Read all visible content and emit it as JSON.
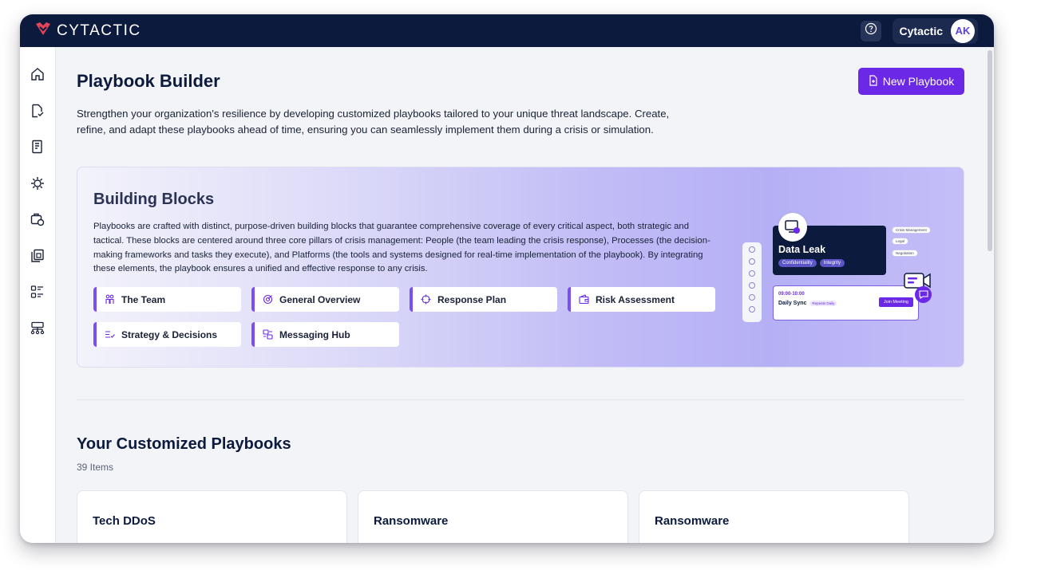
{
  "brand": {
    "name": "CYTACTIC",
    "color": "#e0455a"
  },
  "topbar": {
    "help_icon": "help-circle-icon",
    "user_name": "Cytactic",
    "avatar_initials": "AK"
  },
  "sidebar": {
    "items": [
      {
        "icon": "home-icon"
      },
      {
        "icon": "document-check-icon"
      },
      {
        "icon": "checklist-icon"
      },
      {
        "icon": "virus-icon"
      },
      {
        "icon": "briefcase-settings-icon"
      },
      {
        "icon": "copy-document-icon"
      },
      {
        "icon": "workflow-icon"
      },
      {
        "icon": "org-chart-icon"
      }
    ]
  },
  "header": {
    "title": "Playbook Builder",
    "new_button_label": "New Playbook",
    "intro": "Strengthen your organization's resilience by developing customized playbooks tailored to your unique threat landscape. Create, refine, and adapt these playbooks ahead of time, ensuring you can seamlessly implement them during a crisis or simulation."
  },
  "building_blocks": {
    "title": "Building Blocks",
    "description": "Playbooks are crafted with distinct, purpose-driven building blocks that guarantee comprehensive coverage of every critical aspect, both strategic and tactical. These blocks are centered around three core pillars of crisis management: People (the team leading the crisis response), Processes (the decision-making frameworks and tasks they execute), and Platforms (the tools and systems designed for real-time implementation of the playbook). By integrating these elements, the playbook ensures a unified and effective response to any crisis.",
    "chips": [
      {
        "label": "The Team",
        "icon": "team-icon"
      },
      {
        "label": "General Overview",
        "icon": "target-icon"
      },
      {
        "label": "Response Plan",
        "icon": "crosshair-icon"
      },
      {
        "label": "Risk Assessment",
        "icon": "wallet-icon"
      },
      {
        "label": "Strategy & Decisions",
        "icon": "list-check-icon"
      },
      {
        "label": "Messaging Hub",
        "icon": "messages-icon"
      }
    ],
    "illustration": {
      "leak_title": "Data Leak",
      "tags": [
        "Confidentiality",
        "Integrity"
      ],
      "side_tags": [
        "Crisis Management",
        "Legal",
        "Negotiation"
      ],
      "sync_time": "09:00-10:00",
      "sync_name": "Daily Sync",
      "sync_repeat": "Repeats Daily",
      "join_label": "Join Meeting"
    }
  },
  "playbooks": {
    "title": "Your Customized Playbooks",
    "count": "39 Items",
    "cards": [
      {
        "title": "Tech DDoS"
      },
      {
        "title": "Ransomware"
      },
      {
        "title": "Ransomware"
      }
    ]
  },
  "colors": {
    "topbar": "#0c1b3d",
    "accent": "#6b28e6",
    "background": "#f3f4f7"
  }
}
